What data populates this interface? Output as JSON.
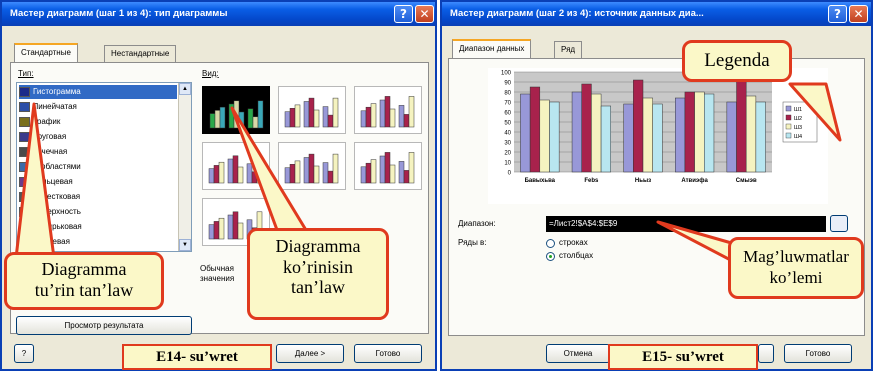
{
  "left_window": {
    "title": "Мастер диаграмм (шаг 1 из 4): тип диаграммы",
    "help_glyph": "?",
    "close_glyph": "✕",
    "tabs": [
      "Стандартные",
      "Нестандартные"
    ],
    "type_label": "Тип:",
    "view_label": "Вид:",
    "chart_types": [
      {
        "label": "Гистограмма",
        "icon": "bar-chart-icon",
        "selected": true
      },
      {
        "label": "Линейчатая",
        "icon": "horizontal-bar-icon"
      },
      {
        "label": "График",
        "icon": "line-chart-icon"
      },
      {
        "label": "Круговая",
        "icon": "pie-chart-icon"
      },
      {
        "label": "Точечная",
        "icon": "scatter-chart-icon"
      },
      {
        "label": "С областями",
        "icon": "area-chart-icon"
      },
      {
        "label": "Кольцевая",
        "icon": "doughnut-chart-icon"
      },
      {
        "label": "Лепестковая",
        "icon": "radar-chart-icon"
      },
      {
        "label": "Поверхность",
        "icon": "surface-chart-icon"
      },
      {
        "label": "Пузырьковая",
        "icon": "bubble-chart-icon"
      },
      {
        "label": "Биржевая",
        "icon": "stock-chart-icon"
      }
    ],
    "description": [
      "Обычная",
      "значения"
    ],
    "preview_button": "Просмотр результата",
    "next_button": "Далее >",
    "finish_button": "Готово",
    "help_button": "?"
  },
  "right_window": {
    "title": "Мастер диаграмм (шаг 2 из 4): источник данных диа...",
    "help_glyph": "?",
    "close_glyph": "✕",
    "tabs": [
      "Диапазон данных",
      "Ряд"
    ],
    "range_label": "Диапазон:",
    "range_value": "=Лист2!$A$4:$E$9",
    "series_label": "Ряды в:",
    "series_options": [
      {
        "label": "строках",
        "selected": false
      },
      {
        "label": "столбцах",
        "selected": true
      }
    ],
    "cancel_button": "Отмена",
    "finish_button": "Готово"
  },
  "callouts": {
    "type_choice": [
      "Diagramma",
      "tu’rin tan’law"
    ],
    "view_choice": [
      "Diagramma",
      "ko’rinisin",
      "tan’law"
    ],
    "legend": "Legenda",
    "data_range": [
      "Mag’luwmatlar",
      "ko’lemi"
    ]
  },
  "captions": {
    "left": "E14- su’wret",
    "right": "E15- su’wret"
  },
  "colors": {
    "title_blue": "#0a5ee6",
    "callout_border": "#e03a1e",
    "callout_fill": "#fbf8c8",
    "series": [
      "#9898d8",
      "#a8224c",
      "#f5f3c0",
      "#b8e6f0"
    ]
  },
  "chart_data": {
    "type": "bar",
    "categories": [
      "Бавыхьва",
      "Febs",
      "Ньыз",
      "Атвиэфа",
      "Смыэв"
    ],
    "series": [
      {
        "name": "Ш1",
        "values": [
          78,
          80,
          68,
          74,
          70
        ]
      },
      {
        "name": "Ш2",
        "values": [
          85,
          88,
          92,
          80,
          95
        ]
      },
      {
        "name": "Ш3",
        "values": [
          72,
          78,
          74,
          80,
          76
        ]
      },
      {
        "name": "Ш4",
        "values": [
          70,
          66,
          68,
          78,
          70
        ]
      }
    ],
    "y_ticks": [
      "100",
      "90",
      "80",
      "70",
      "60",
      "50",
      "40",
      "30",
      "20",
      "10",
      "0"
    ],
    "ylim": [
      0,
      100
    ],
    "grid": true,
    "legend_placement": "right"
  }
}
